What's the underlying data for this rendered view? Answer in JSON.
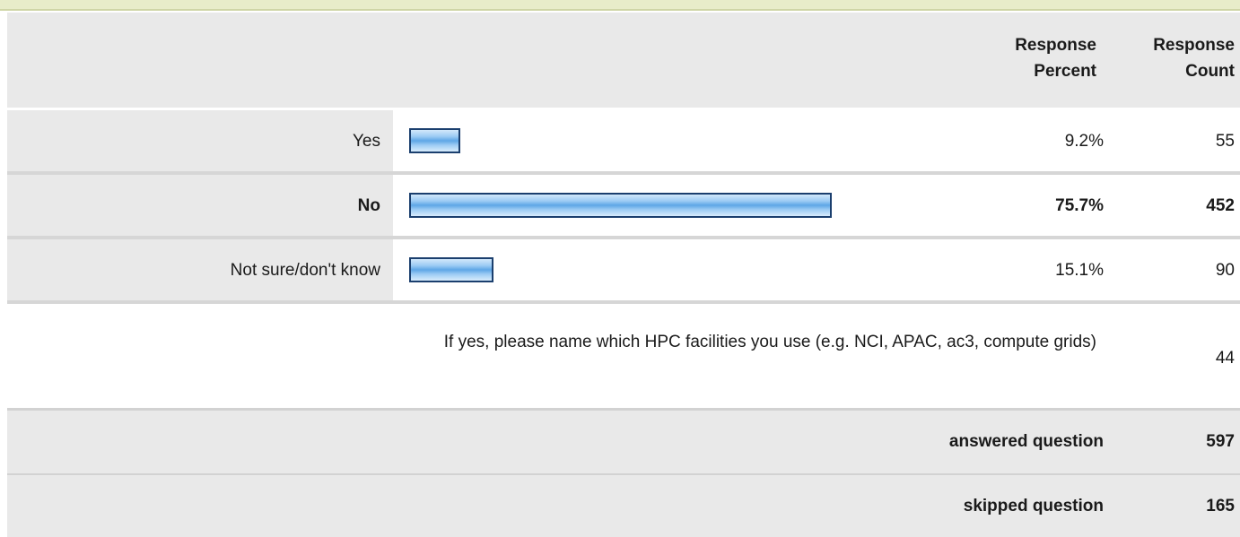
{
  "header": {
    "percent_line1": "Response",
    "percent_line2": "Percent",
    "count_line1": "Response",
    "count_line2": "Count"
  },
  "chart_data": {
    "type": "bar",
    "orientation": "horizontal",
    "categories": [
      "Yes",
      "No",
      "Not sure/don't know"
    ],
    "values": [
      9.2,
      75.7,
      15.1
    ],
    "percent_labels": [
      "9.2%",
      "75.7%",
      "15.1%"
    ],
    "counts": [
      "55",
      "452",
      "90"
    ],
    "highlighted": [
      false,
      true,
      false
    ],
    "xlim": [
      0,
      100
    ],
    "bar_color": "#5ea6e6",
    "bar_border_color": "#1b3f6e"
  },
  "other": {
    "text": "If yes, please name which HPC facilities you use (e.g. NCI, APAC, ac3, compute grids)",
    "count": "44"
  },
  "summary": {
    "answered_label": "answered question",
    "answered_value": "597",
    "skipped_label": "skipped question",
    "skipped_value": "165"
  }
}
